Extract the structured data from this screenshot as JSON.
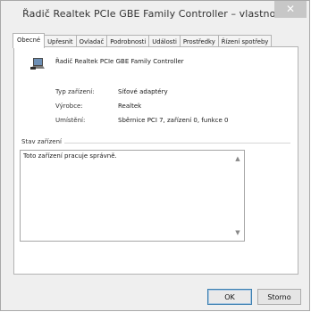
{
  "window": {
    "title": "Řadič Realtek PCIe GBE Family Controller – vlastnosti",
    "close_glyph": "✕"
  },
  "tabs": [
    {
      "label": "Obecné",
      "active": true
    },
    {
      "label": "Upřesnit"
    },
    {
      "label": "Ovladač"
    },
    {
      "label": "Podrobnosti"
    },
    {
      "label": "Události"
    },
    {
      "label": "Prostředky"
    },
    {
      "label": "Řízení spotřeby"
    }
  ],
  "general": {
    "device_name": "Řadič Realtek PCIe GBE Family Controller",
    "device_icon": "network-adapter-icon",
    "properties": [
      {
        "label": "Typ zařízení:",
        "value": "Síťové adaptéry"
      },
      {
        "label": "Výrobce:",
        "value": "Realtek"
      },
      {
        "label": "Umístění:",
        "value": "Sběrnice PCI 7, zařízení 0, funkce 0"
      }
    ],
    "status_group_title": "Stav zařízení",
    "status_text": "Toto zařízení pracuje správně."
  },
  "buttons": {
    "ok": "OK",
    "cancel": "Storno"
  }
}
